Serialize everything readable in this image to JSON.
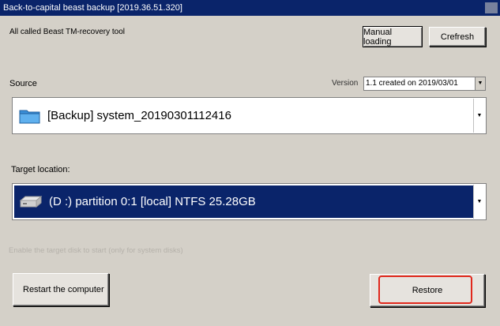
{
  "window": {
    "title": "Back-to-capital beast backup [2019.36.51.320]"
  },
  "app": {
    "description": "All called Beast TM-recovery tool"
  },
  "toolbar": {
    "manual_loading_label": "Manual loading",
    "refresh_label": "Crefresh"
  },
  "source": {
    "label": "Source",
    "version_label": "Version",
    "version_value": "1.1 created on 2019/03/01",
    "selected_item": "[Backup] system_20190301112416",
    "icon": "folder-icon"
  },
  "target": {
    "label": "Target location:",
    "selected_item": "(D :) partition 0:1 [local] NTFS 25.28GB",
    "icon": "hard-drive-icon"
  },
  "options": {
    "enable_target_disk_label": "Enable the target disk to start (only for system disks)"
  },
  "actions": {
    "restart_label": "Restart the computer",
    "restore_label": "Restore"
  },
  "colors": {
    "titlebar": "#0a246a",
    "selection": "#0a246a",
    "highlight_ring": "#e0281c",
    "window_bg": "#d4d0c8"
  }
}
